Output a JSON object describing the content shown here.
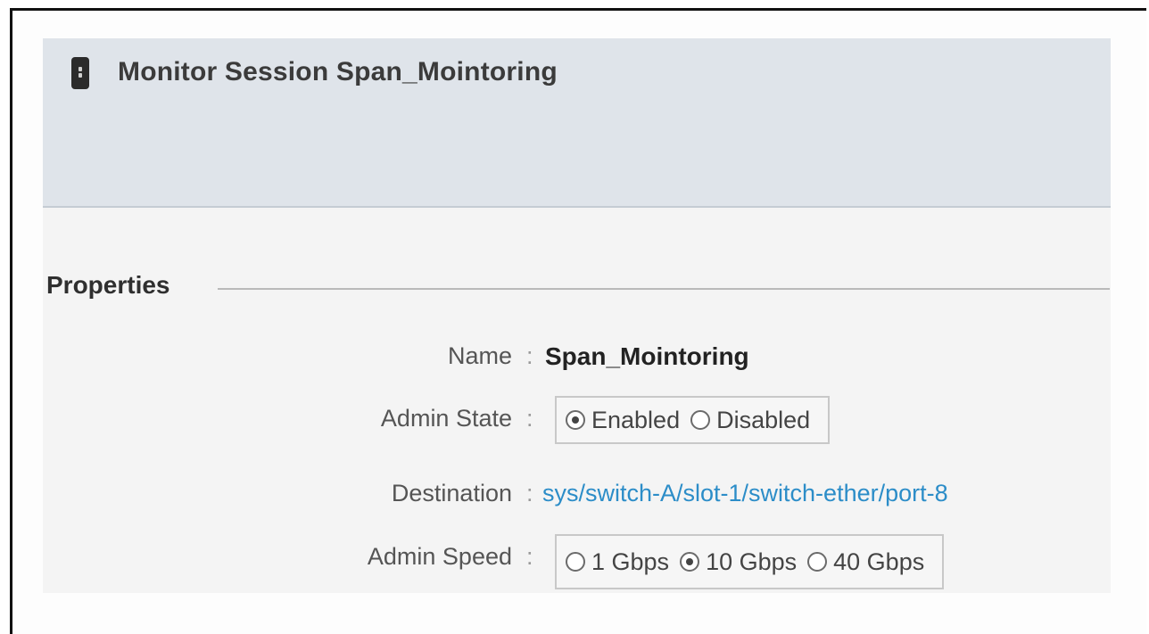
{
  "header": {
    "title": "Monitor Session Span_Mointoring",
    "icon": "server-icon"
  },
  "properties": {
    "section_title": "Properties",
    "name": {
      "label": "Name",
      "value": "Span_Mointoring"
    },
    "admin_state": {
      "label": "Admin State",
      "options": [
        {
          "label": "Enabled",
          "checked": true
        },
        {
          "label": "Disabled",
          "checked": false
        }
      ]
    },
    "destination": {
      "label": "Destination",
      "value": "sys/switch-A/slot-1/switch-ether/port-8",
      "link_color": "#2c8dc8"
    },
    "admin_speed": {
      "label": "Admin Speed",
      "options": [
        {
          "label": "1 Gbps",
          "checked": false
        },
        {
          "label": "10 Gbps",
          "checked": true
        },
        {
          "label": "40 Gbps",
          "checked": false
        }
      ]
    }
  },
  "separator": ":"
}
